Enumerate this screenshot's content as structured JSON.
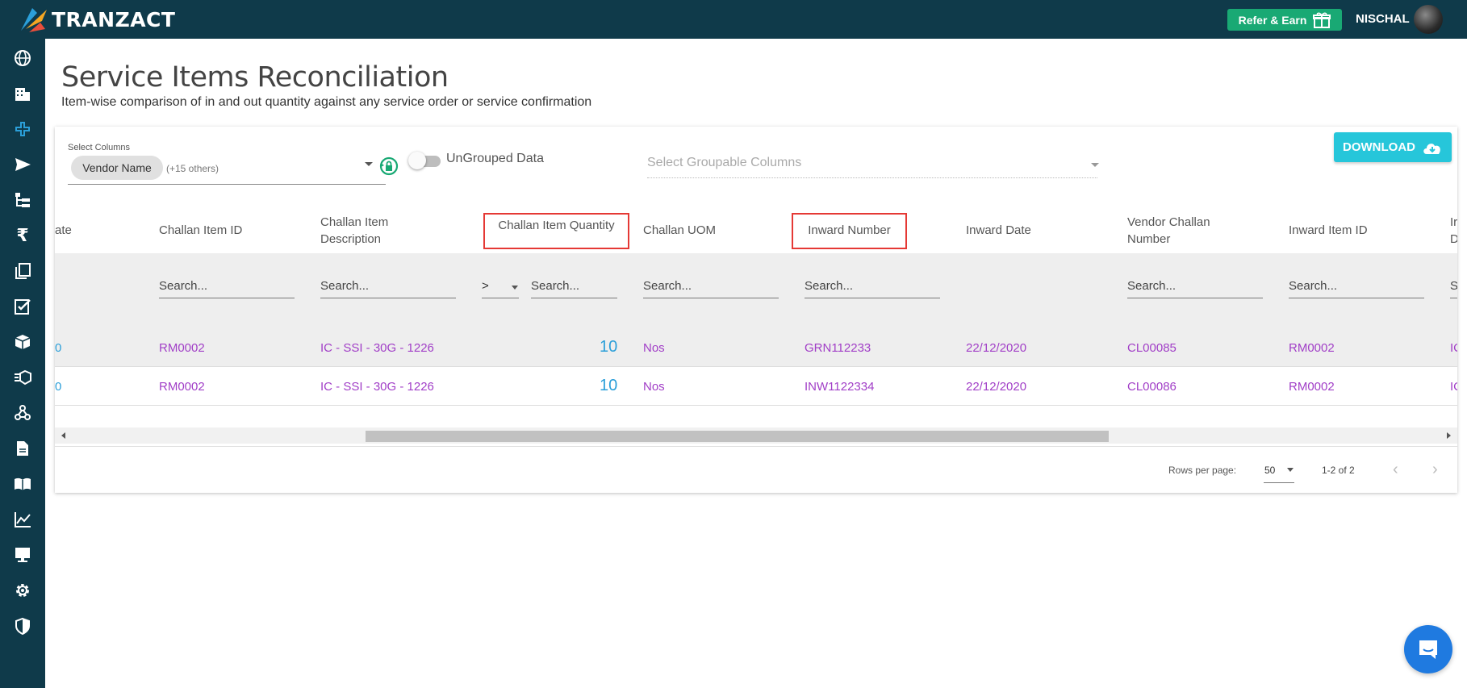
{
  "app": {
    "brand": "TRANZACT"
  },
  "header": {
    "refer_label": "Refer & Earn",
    "user_name": "NISCHAL"
  },
  "sidebar": {
    "items": [
      "globe-icon",
      "building-icon",
      "plus-icon",
      "send-icon",
      "hierarchy-icon",
      "rupee-icon",
      "documents-icon",
      "checklist-icon",
      "box-icon",
      "box-list-icon",
      "network-icon",
      "file-icon",
      "book-icon",
      "chart-icon",
      "monitor-icon",
      "gear-icon",
      "shield-icon"
    ],
    "active_color": "#2b9fd9"
  },
  "page": {
    "title": "Service Items Reconciliation",
    "subtitle": "Item-wise comparison of in and out quantity against any service order or service confirmation"
  },
  "controls": {
    "select_columns_label": "Select Columns",
    "selected_chip": "Vendor Name",
    "others_text": "(+15 others)",
    "toggle_label": "UnGrouped Data",
    "groupable_placeholder": "Select Groupable Columns",
    "download_label": "DOWNLOAD"
  },
  "table": {
    "columns": [
      "ate",
      "Challan Item ID",
      "Challan Item Description",
      "Challan Item Quantity",
      "Challan UOM",
      "Inward Number",
      "Inward Date",
      "Vendor Challan Number",
      "Inward Item ID",
      "Ir D"
    ],
    "column_lines": {
      "desc_1": "Challan Item",
      "desc_2": "Description",
      "vcn_1": "Vendor Challan",
      "vcn_2": "Number",
      "last_1": "Ir",
      "last_2": "D"
    },
    "search_placeholder": "Search...",
    "search_partial": "S",
    "operator": ">",
    "rows": [
      {
        "c0": "0",
        "challan_item_id": "RM0002",
        "desc": "IC - SSI - 30G - 1226",
        "qty": "10",
        "uom": "Nos",
        "inward_number": "GRN112233",
        "inward_date": "22/12/2020",
        "vendor_challan": "CL00085",
        "inward_item_id": "RM0002",
        "last": "IC"
      },
      {
        "c0": "0",
        "challan_item_id": "RM0002",
        "desc": "IC - SSI - 30G - 1226",
        "qty": "10",
        "uom": "Nos",
        "inward_number": "INW1122334",
        "inward_date": "22/12/2020",
        "vendor_challan": "CL00086",
        "inward_item_id": "RM0002",
        "last": "IC"
      }
    ]
  },
  "pagination": {
    "rows_per_page_label": "Rows per page:",
    "rows_per_page": "50",
    "range": "1-2 of 2",
    "prev": "‹",
    "next": "›"
  },
  "colors": {
    "topbar": "#0f3a4a",
    "refer": "#19a974",
    "download": "#26c6da",
    "link": "#a13ec7",
    "number": "#2b9fd9",
    "highlight": "#e53935"
  }
}
